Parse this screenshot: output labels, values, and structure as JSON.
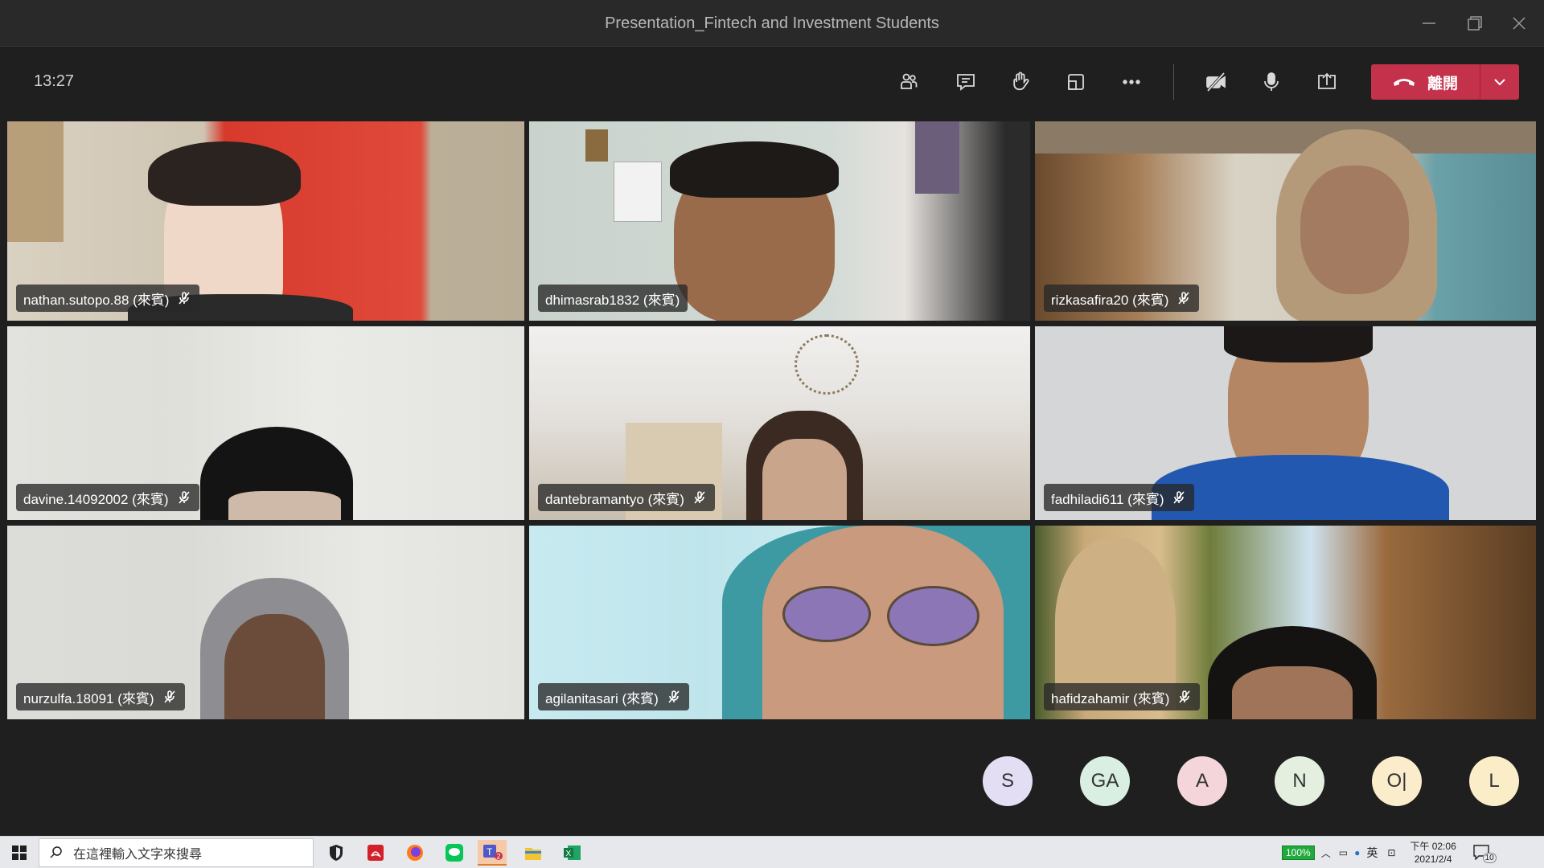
{
  "window": {
    "title": "Presentation_Fintech and Investment Students"
  },
  "toolbar": {
    "time": "13:27",
    "leave_label": "離開",
    "buttons": [
      "participants-icon",
      "chat-icon",
      "raise-hand-icon",
      "rooms-icon",
      "more-icon",
      "camera-off-icon",
      "microphone-icon",
      "share-screen-icon"
    ]
  },
  "participants": [
    {
      "name": "nathan.sutopo.88 (來賓)",
      "muted": true
    },
    {
      "name": "dhimasrab1832 (來賓)",
      "muted": false
    },
    {
      "name": "rizkasafira20 (來賓)",
      "muted": true
    },
    {
      "name": "davine.14092002 (來賓)",
      "muted": true
    },
    {
      "name": "dantebramantyo (來賓)",
      "muted": true
    },
    {
      "name": "fadhiladi611 (來賓)",
      "muted": true
    },
    {
      "name": "nurzulfa.18091 (來賓)",
      "muted": true
    },
    {
      "name": "agilanitasari (來賓)",
      "muted": true
    },
    {
      "name": "hafidzahamir (來賓)",
      "muted": true
    }
  ],
  "avatars": [
    {
      "initials": "S",
      "color": "#e3def4"
    },
    {
      "initials": "GA",
      "color": "#d8efe2"
    },
    {
      "initials": "A",
      "color": "#f4d6da"
    },
    {
      "initials": "N",
      "color": "#e4efdf"
    },
    {
      "initials": "O|",
      "color": "#fbeccb"
    },
    {
      "initials": "L",
      "color": "#fbedc8"
    }
  ],
  "taskbar": {
    "search_placeholder": "在這裡輸入文字來搜尋",
    "battery": "100%",
    "ime": "英",
    "clock_time": "下午 02:06",
    "clock_date": "2021/2/4",
    "notifications": "10",
    "teams_badge": "2"
  }
}
